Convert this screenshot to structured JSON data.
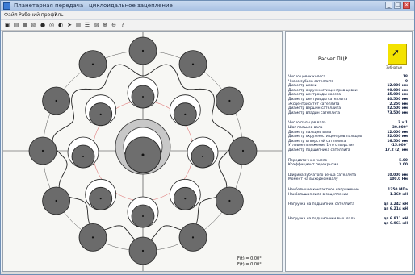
{
  "window": {
    "title": "Планетарная передача | циклоидальное зацепление",
    "buttons": [
      "_",
      "□",
      "×"
    ]
  },
  "menu": [
    "Файл",
    "Рабочий профиль",
    "?"
  ],
  "toolbar_icons": [
    "new-icon",
    "open-icon",
    "save-icon",
    "print-icon",
    "gear-icon",
    "ring-icon",
    "wheel-icon",
    "arrow-icon",
    "grid-icon",
    "layers-icon",
    "chart-icon",
    "zoom-in-icon",
    "zoom-out-icon",
    "help-icon"
  ],
  "toolbar_glyphs": [
    "▣",
    "▤",
    "▦",
    "▧",
    "●",
    "◎",
    "◐",
    "➤",
    "▥",
    "☰",
    "▨",
    "⊕",
    "⊖",
    "?"
  ],
  "drawing": {
    "fi_lines": [
      "F(t) = 0.00°",
      "F(t) = 0.00°"
    ]
  },
  "panel": {
    "title": "Расчет ПЦР",
    "logo_text": "Зубчатые",
    "groups": [
      [
        {
          "label": "Число цевок колеса",
          "value": "18"
        },
        {
          "label": "Число зубьев сателлита",
          "value": "9"
        },
        {
          "label": "Диаметр цевки",
          "value": "12.000 мм"
        },
        {
          "label": "Диаметр окружности центров цевки",
          "value": "90.000 мм"
        },
        {
          "label": "Диаметр центроиды колеса",
          "value": "45.000 мм"
        },
        {
          "label": "Диаметр центроиды сателлита",
          "value": "40.500 мм"
        },
        {
          "label": "Эксцентриситет сателлита",
          "value": "2.250 мм"
        },
        {
          "label": "Диаметр вершин сателлита",
          "value": "82.500 мм"
        },
        {
          "label": "Диаметр впадин сателлита",
          "value": "73.500 мм"
        }
      ],
      [
        {
          "label": "Число пальцев вала",
          "value": "3 x 1"
        },
        {
          "label": "Шаг пальцев вала",
          "value": "30.000°"
        },
        {
          "label": "Диаметр пальцев вала",
          "value": "12.000 мм"
        },
        {
          "label": "Диаметр окружности центров пальцев",
          "value": "52.000 мм"
        },
        {
          "label": "Диаметр отверстий сателлита",
          "value": "16.500 мм"
        },
        {
          "label": "Угловое положение 1-го отверстия",
          "value": "-15.000°"
        },
        {
          "label": "Диаметр подшипника сателлита",
          "value": "17.2 (2) мм"
        }
      ],
      [
        {
          "label": "Передаточное число",
          "value": "5.00"
        },
        {
          "label": "Коэффициент перекрытия",
          "value": "3.00"
        }
      ],
      [
        {
          "label": "Ширина зубчатого венца сателлита",
          "value": "10.000 мм"
        },
        {
          "label": "Момент на выходном валу",
          "value": "100.0 Нм"
        }
      ],
      [
        {
          "label": "Наибольшее контактное напряжение",
          "value": "1250 МПа"
        },
        {
          "label": "Наибольшая сила в зацеплении",
          "value": "1.360 кН"
        }
      ],
      [
        {
          "label": "Нагрузка на подшипник сателлита",
          "value": "дп 3.242 кН"
        },
        {
          "label": "",
          "value": "дп 6.214 кН"
        }
      ],
      [
        {
          "label": "Нагрузка на подшипники вых. вала",
          "value": "дп 6.811 кН"
        },
        {
          "label": "",
          "value": "дп 6.961 кН"
        }
      ]
    ]
  }
}
